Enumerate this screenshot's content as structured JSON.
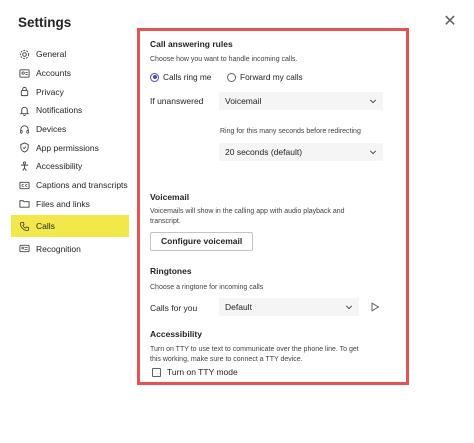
{
  "dialog": {
    "title": "Settings",
    "close_glyph": "✕"
  },
  "sidebar": {
    "items": [
      {
        "label": "General",
        "icon": "gear-icon"
      },
      {
        "label": "Accounts",
        "icon": "accounts-icon"
      },
      {
        "label": "Privacy",
        "icon": "lock-icon"
      },
      {
        "label": "Notifications",
        "icon": "bell-icon"
      },
      {
        "label": "Devices",
        "icon": "headset-icon"
      },
      {
        "label": "App permissions",
        "icon": "shield-icon"
      },
      {
        "label": "Accessibility",
        "icon": "accessibility-icon"
      },
      {
        "label": "Captions and transcripts",
        "icon": "captions-icon"
      },
      {
        "label": "Files and links",
        "icon": "folder-icon"
      },
      {
        "label": "Calls",
        "icon": "phone-icon",
        "active": true
      },
      {
        "label": "Recognition",
        "icon": "recognition-icon"
      }
    ],
    "active_highlight_color": "#f2e84a"
  },
  "calls": {
    "answering": {
      "heading": "Call answering rules",
      "description": "Choose how you want to handle incoming calls.",
      "option_ring": "Calls ring me",
      "option_forward": "Forward my calls",
      "selected": "Calls ring me",
      "if_unanswered_label": "If unanswered",
      "if_unanswered_value": "Voicemail",
      "ring_label": "Ring for this many seconds before redirecting",
      "ring_value": "20 seconds (default)"
    },
    "voicemail": {
      "heading": "Voicemail",
      "description_line1": "Voicemails will show in the calling app with audio playback and",
      "description_line2": "transcript.",
      "button": "Configure voicemail"
    },
    "ringtones": {
      "heading": "Ringtones",
      "description": "Choose a ringtone for incoming calls",
      "calls_for_you_label": "Calls for you",
      "calls_for_you_value": "Default"
    },
    "accessibility": {
      "heading": "Accessibility",
      "description_line1": "Turn on TTY to use text to communicate over the phone line. To get",
      "description_line2": "this working, make sure to connect a TTY device.",
      "tty_label": "Turn on TTY mode",
      "tty_checked": false
    }
  },
  "colors": {
    "accent": "#464eb8",
    "panel_border": "#e35353"
  }
}
